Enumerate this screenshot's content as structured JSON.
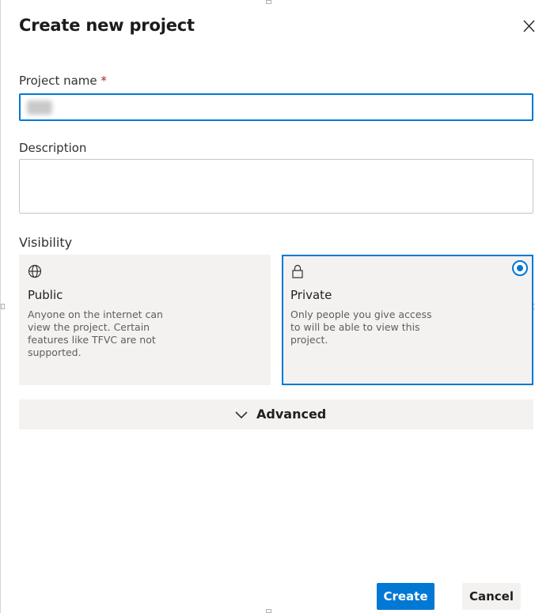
{
  "dialog": {
    "title": "Create new project",
    "close_icon": "close-icon"
  },
  "fields": {
    "project_name": {
      "label": "Project name",
      "required_marker": "*",
      "value": ""
    },
    "description": {
      "label": "Description",
      "value": ""
    }
  },
  "visibility": {
    "label": "Visibility",
    "selected": "Private",
    "options": [
      {
        "title": "Public",
        "icon": "globe-icon",
        "description": "Anyone on the internet can view the project. Certain features like TFVC are not supported."
      },
      {
        "title": "Private",
        "icon": "lock-icon",
        "description": "Only people you give access to will be able to view this project."
      }
    ]
  },
  "advanced": {
    "label": "Advanced",
    "icon": "chevron-down-icon"
  },
  "buttons": {
    "create": "Create",
    "cancel": "Cancel"
  },
  "colors": {
    "accent": "#0078d4",
    "card_bg": "#f3f2f1",
    "required": "#a4262c"
  }
}
